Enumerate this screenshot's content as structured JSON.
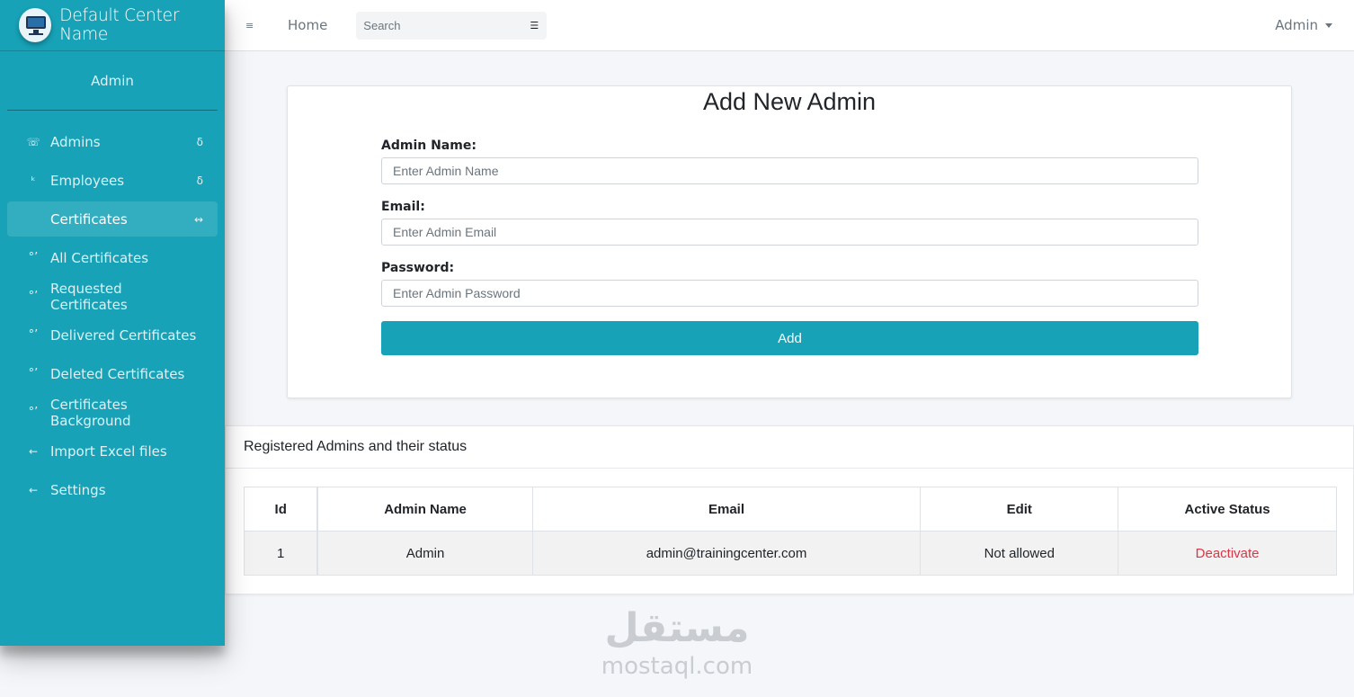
{
  "brand": {
    "name": "Default Center Name",
    "logo_icon": "computer-monitor-logo"
  },
  "user_panel": {
    "name": "Admin"
  },
  "sidebar": {
    "items": [
      {
        "label": "Admins",
        "icon": "☏",
        "caret": "δ",
        "active": false
      },
      {
        "label": "Employees",
        "icon": "ᵏ",
        "caret": "δ",
        "active": false
      },
      {
        "label": "Certificates",
        "icon": "",
        "caret": "↭",
        "active": true
      },
      {
        "label": "All Certificates",
        "icon": "°’",
        "caret": "",
        "active": false
      },
      {
        "label": "Requested Certificates",
        "icon": "°’",
        "caret": "",
        "active": false
      },
      {
        "label": "Delivered Certificates",
        "icon": "°’",
        "caret": "",
        "active": false
      },
      {
        "label": "Deleted Certificates",
        "icon": "°’",
        "caret": "",
        "active": false
      },
      {
        "label": "Certificates Background",
        "icon": "°’",
        "caret": "",
        "active": false
      },
      {
        "label": "Import Excel files",
        "icon": "←",
        "caret": "",
        "active": false
      },
      {
        "label": "Settings",
        "icon": "←",
        "caret": "",
        "active": false
      }
    ]
  },
  "topbar": {
    "menu_icon": "≡",
    "home": "Home",
    "search_placeholder": "Search",
    "search_icon": "☰",
    "user": "Admin"
  },
  "form": {
    "title": "Add New Admin",
    "name_label": "Admin Name:",
    "name_placeholder": "Enter Admin Name",
    "email_label": "Email:",
    "email_placeholder": "Enter Admin Email",
    "password_label": "Password:",
    "password_placeholder": "Enter Admin Password",
    "submit_label": "Add"
  },
  "admins_table": {
    "title": "Registered Admins and their status",
    "columns": [
      "Id",
      "Admin Name",
      "Email",
      "Edit",
      "Active Status"
    ],
    "rows": [
      {
        "id": "1",
        "name": "Admin",
        "email": "admin@trainingcenter.com",
        "edit": "Not allowed",
        "status": "Deactivate"
      }
    ]
  },
  "watermark": {
    "arabic": "مستقل",
    "latin": "mostaql.com"
  },
  "colors": {
    "accent": "#17a2b8",
    "danger": "#dc3545",
    "background": "#f4f6f9"
  }
}
